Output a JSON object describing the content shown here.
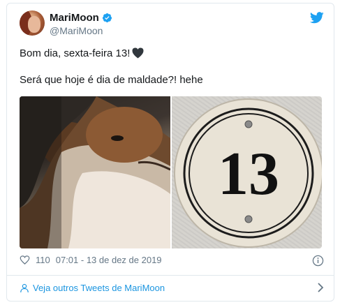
{
  "tweet": {
    "author": {
      "display_name": "MariMoon",
      "handle": "@MariMoon",
      "verified": true
    },
    "text_line1": "Bom dia, sexta-feira 13!",
    "text_line2": "Será que hoje é dia de maldade?! hehe",
    "emoji": "black-heart",
    "media": {
      "left_image": "dog-side-eye-photo",
      "right_image": "house-number-plaque",
      "plaque_number": "13"
    },
    "likes": "110",
    "timestamp": "07:01 - 13 de dez de 2019"
  },
  "footer": {
    "more_tweets_label": "Veja outros Tweets de MariMoon"
  },
  "colors": {
    "accent": "#1da1f2",
    "link": "#1b95e0",
    "muted": "#657786",
    "border": "#e1e8ed"
  },
  "icons": [
    "verified-icon",
    "twitter-bird-icon",
    "heart-outline-icon",
    "info-icon",
    "person-icon",
    "chevron-right-icon"
  ]
}
